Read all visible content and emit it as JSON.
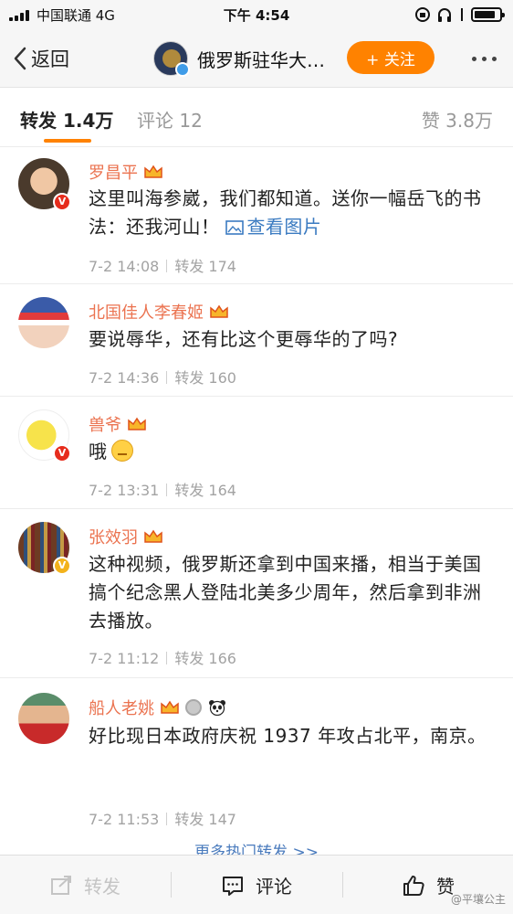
{
  "status_bar": {
    "carrier": "中国联通  4G",
    "time": "下午 4:54",
    "battery_level": 0.85
  },
  "nav": {
    "back_label": "返回",
    "account_title": "俄罗斯驻华大…",
    "follow_label": "+ 关注"
  },
  "tabs": {
    "repost": "转发 1.4万",
    "comment": "评论 12",
    "likes": "赞 3.8万"
  },
  "reposts": [
    {
      "author": "罗昌平",
      "text": "这里叫海参崴，我们都知道。送你一幅岳飞的书法：还我河山！",
      "view_pic": "查看图片",
      "time": "7-2 14:08",
      "reposts": "转发 174",
      "badge": "red"
    },
    {
      "author": "北国佳人李春姬",
      "text": "要说辱华，还有比这个更辱华的了吗?",
      "time": "7-2 14:36",
      "reposts": "转发 160",
      "badge": ""
    },
    {
      "author": "兽爷",
      "text": "哦",
      "time": "7-2 13:31",
      "reposts": "转发 164",
      "badge": "red"
    },
    {
      "author": "张效羽",
      "text": "这种视频，俄罗斯还拿到中国来播，相当于美国搞个纪念黑人登陆北美多少周年，然后拿到非洲去播放。",
      "time": "7-2 11:12",
      "reposts": "转发 166",
      "badge": "gold"
    },
    {
      "author": "船人老姚",
      "text": "好比现日本政府庆祝 1937 年攻占北平，南京。",
      "time": "7-2 11:53",
      "reposts": "转发 147",
      "badge": ""
    }
  ],
  "more_hot": "更多热门转发 >>",
  "bottom_bar": {
    "repost": "转发",
    "comment": "评论",
    "like": "赞"
  },
  "watermark": "@平壤公主",
  "colors": {
    "accent": "#ff8200",
    "author": "#eb7350",
    "link": "#3b7bc1"
  }
}
